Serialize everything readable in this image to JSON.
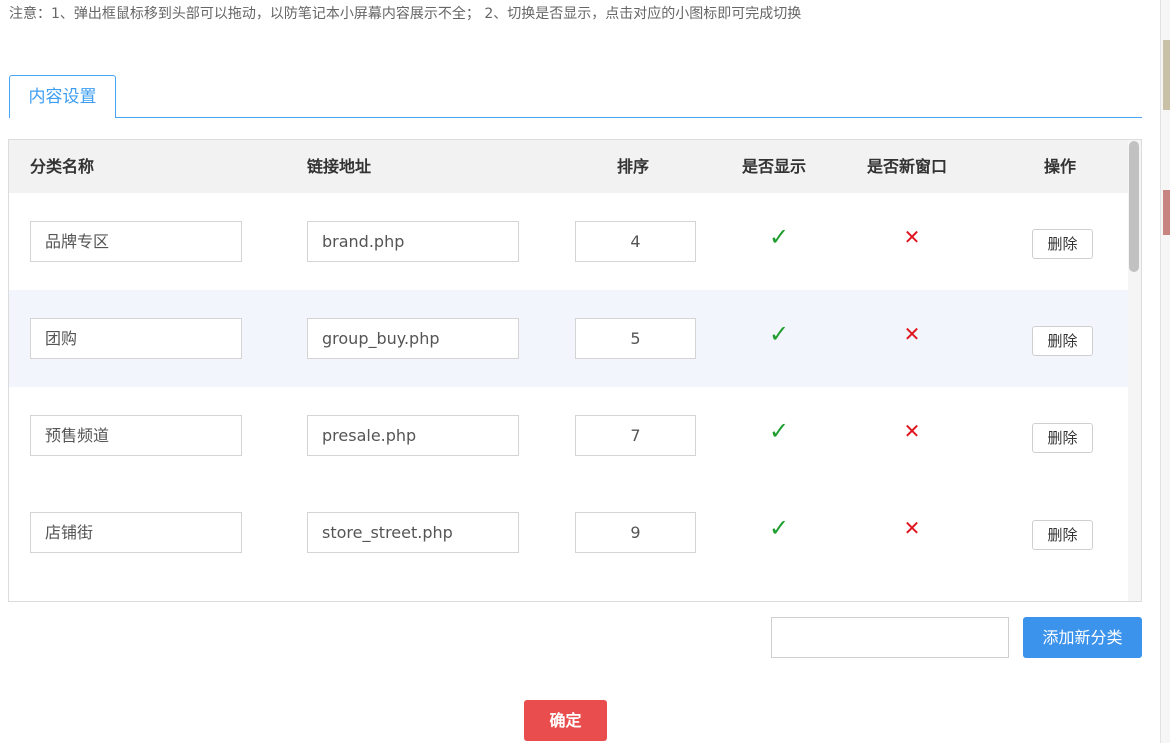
{
  "notice": "注意：1、弹出框鼠标移到头部可以拖动，以防笔记本小屏幕内容展示不全；  2、切换是否显示，点击对应的小图标即可完成切换",
  "tabs": [
    {
      "label": "内容设置",
      "active": true
    }
  ],
  "table": {
    "headers": {
      "name": "分类名称",
      "url": "链接地址",
      "sort": "排序",
      "show": "是否显示",
      "new_window": "是否新窗口",
      "action": "操作"
    },
    "rows": [
      {
        "name": "品牌专区",
        "url": "brand.php",
        "sort": "4",
        "show": true,
        "new_window": false,
        "delete_label": "删除"
      },
      {
        "name": "团购",
        "url": "group_buy.php",
        "sort": "5",
        "show": true,
        "new_window": false,
        "delete_label": "删除"
      },
      {
        "name": "预售频道",
        "url": "presale.php",
        "sort": "7",
        "show": true,
        "new_window": false,
        "delete_label": "删除"
      },
      {
        "name": "店铺街",
        "url": "store_street.php",
        "sort": "9",
        "show": true,
        "new_window": false,
        "delete_label": "删除"
      }
    ]
  },
  "footer": {
    "new_category_value": "",
    "add_button_label": "添加新分类",
    "confirm_button_label": "确定"
  },
  "icons": {
    "yes": "check-icon",
    "no": "cross-icon"
  },
  "colors": {
    "accent": "#3b93ec",
    "tab_border": "#48a3f1",
    "check": "#1f9e2f",
    "cross": "#e0141e",
    "confirm": "#e94d4d",
    "row_alt": "#f2f5fc",
    "header_bg": "#f2f2f2"
  }
}
